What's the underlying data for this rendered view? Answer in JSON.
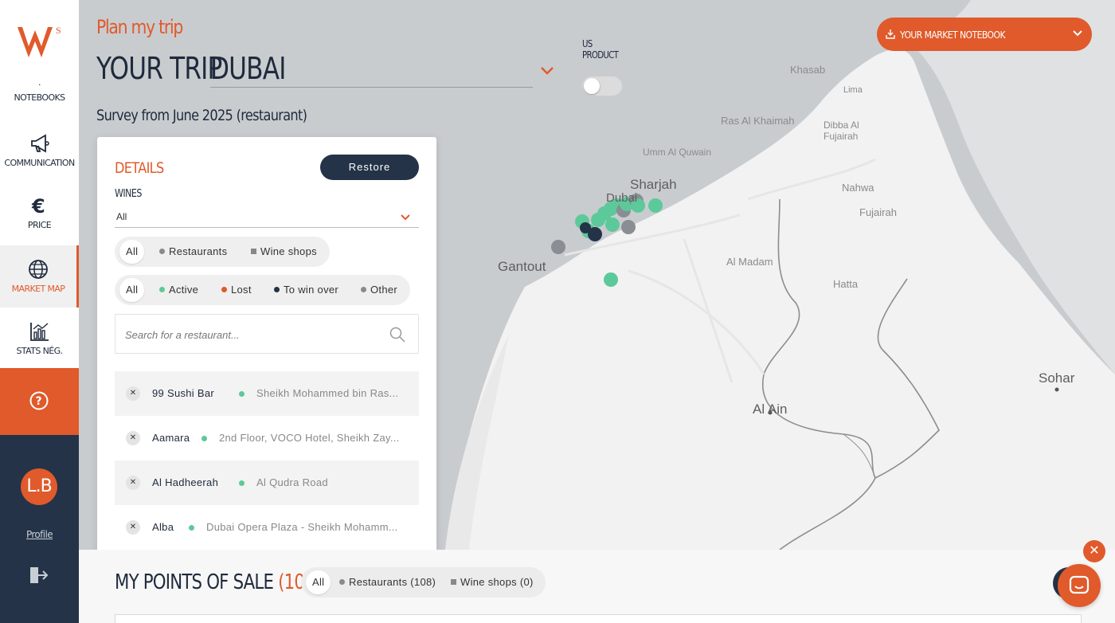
{
  "sidebar": {
    "items": [
      {
        "label": "NOTEBOOKS",
        "icon": "notebook-icon"
      },
      {
        "label": "COMMUNICATION",
        "icon": "megaphone-icon"
      },
      {
        "label": "PRICE",
        "icon": "euro-icon"
      },
      {
        "label": "MARKET MAP",
        "icon": "globe-icon",
        "active": true
      },
      {
        "label": "STATS NÉG.",
        "icon": "stats-icon"
      }
    ],
    "avatar_initials": "L.B",
    "profile_label": "Profile"
  },
  "header": {
    "plan_title": "Plan my trip",
    "trip_prefix": "YOUR TRIP",
    "trip_value": "DUBAI",
    "us_product_label": "US PRODUCT",
    "survey_text": "Survey from June 2025 (restaurant)",
    "notebook_button": "YOUR MARKET NOTEBOOK"
  },
  "map": {
    "places": [
      "Khasab",
      "Lima",
      "Ras Al Khaimah",
      "Dibba Al Fujairah",
      "Umm Al Quwain",
      "Sharjah",
      "Dubai",
      "Nahwa",
      "Fujairah",
      "Gantout",
      "Al Madam",
      "Hatta",
      "Sohar",
      "Al Ain"
    ]
  },
  "details": {
    "title": "DETAILS",
    "restore_label": "Restore",
    "wines_label": "WINES",
    "wines_value": "All",
    "type_filters": [
      "All",
      "Restaurants",
      "Wine shops"
    ],
    "status_filters": [
      "All",
      "Active",
      "Lost",
      "To win over",
      "Other"
    ],
    "search_placeholder": "Search for a restaurant...",
    "rows": [
      {
        "name": "99 Sushi Bar",
        "address": "Sheikh Mohammed bin Ras..."
      },
      {
        "name": "Aamara",
        "address": "2nd Floor, VOCO Hotel, Sheikh Zay..."
      },
      {
        "name": "Al Hadheerah",
        "address": "Al Qudra Road"
      },
      {
        "name": "Alba",
        "address": "Dubai Opera Plaza - Sheikh Mohamm..."
      }
    ]
  },
  "points_of_sale": {
    "title": "MY POINTS OF SALE",
    "count": "(108)",
    "filters": [
      "All",
      "Restaurants (108)",
      "Wine shops (0)"
    ]
  },
  "colors": {
    "accent": "#e05a2b",
    "navy": "#243347",
    "active": "#5cc99a",
    "lost": "#e05a2b",
    "to_win_over": "#243347",
    "other": "#8a8a8a"
  }
}
